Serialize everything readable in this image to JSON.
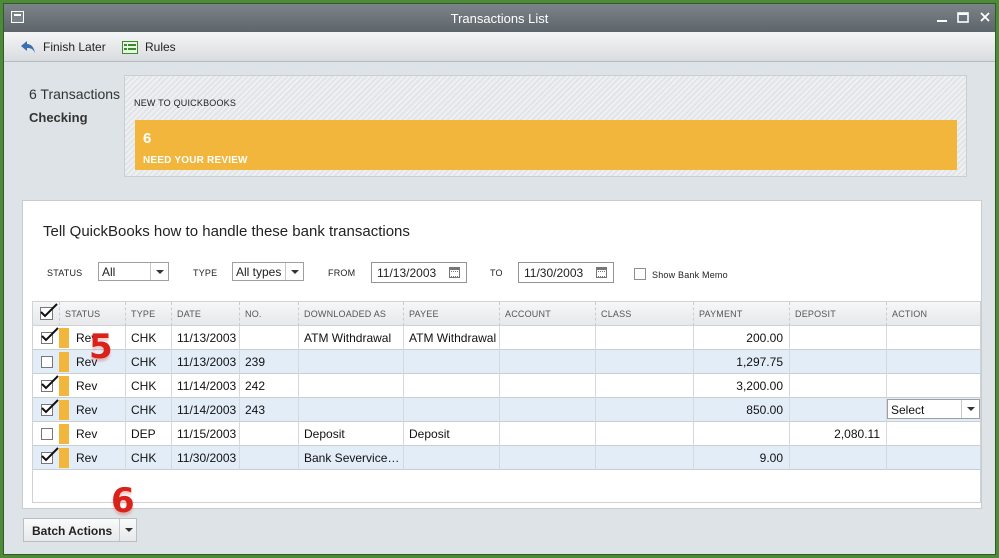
{
  "window": {
    "title": "Transactions List",
    "controls": [
      "minimize-icon",
      "maximize-icon",
      "close-icon"
    ]
  },
  "toolbar": {
    "finish_later": "Finish Later",
    "rules": "Rules"
  },
  "summary": {
    "count": "6 Transactions",
    "account": "Checking",
    "category_label": "NEW TO QUICKBOOKS",
    "review_count": "6",
    "review_label": "NEED YOUR REVIEW"
  },
  "main": {
    "heading": "Tell QuickBooks how to handle these bank transactions"
  },
  "filters": {
    "status_label": "STATUS",
    "status_value": "All",
    "type_label": "TYPE",
    "type_value": "All types",
    "from_label": "FROM",
    "from_value": "11/13/2003",
    "to_label": "TO",
    "to_value": "11/30/2003",
    "show_bank_memo": "Show Bank Memo"
  },
  "grid": {
    "columns": [
      "STATUS",
      "TYPE",
      "DATE",
      "NO.",
      "DOWNLOADED AS",
      "PAYEE",
      "ACCOUNT",
      "CLASS",
      "PAYMENT",
      "DEPOSIT",
      "ACTION"
    ],
    "rows": [
      {
        "checked": true,
        "status": "Rev",
        "type": "CHK",
        "date": "11/13/2003",
        "no": "",
        "downloaded_as": "ATM Withdrawal",
        "payee": "ATM Withdrawal",
        "account": "",
        "class": "",
        "payment": "200.00",
        "deposit": "",
        "action": ""
      },
      {
        "checked": false,
        "status": "Rev",
        "type": "CHK",
        "date": "11/13/2003",
        "no": "239",
        "downloaded_as": "",
        "payee": "",
        "account": "",
        "class": "",
        "payment": "1,297.75",
        "deposit": "",
        "action": ""
      },
      {
        "checked": true,
        "status": "Rev",
        "type": "CHK",
        "date": "11/14/2003",
        "no": "242",
        "downloaded_as": "",
        "payee": "",
        "account": "",
        "class": "",
        "payment": "3,200.00",
        "deposit": "",
        "action": ""
      },
      {
        "checked": true,
        "status": "Rev",
        "type": "CHK",
        "date": "11/14/2003",
        "no": "243",
        "downloaded_as": "",
        "payee": "",
        "account": "",
        "class": "",
        "payment": "850.00",
        "deposit": "",
        "action": "Select"
      },
      {
        "checked": false,
        "status": "Rev",
        "type": "DEP",
        "date": "11/15/2003",
        "no": "",
        "downloaded_as": "Deposit",
        "payee": "Deposit",
        "account": "",
        "class": "",
        "payment": "",
        "deposit": "2,080.11",
        "action": ""
      },
      {
        "checked": true,
        "status": "Rev",
        "type": "CHK",
        "date": "11/30/2003",
        "no": "",
        "downloaded_as": "Bank Severvice…",
        "payee": "",
        "account": "",
        "class": "",
        "payment": "9.00",
        "deposit": "",
        "action": ""
      }
    ]
  },
  "batch": {
    "label": "Batch Actions"
  },
  "annotations": {
    "step5": "5",
    "step6": "6"
  },
  "colors": {
    "accent_orange": "#f2b63c",
    "row_alt": "#e3edf8",
    "titlebar": "#6b7278",
    "annotation_red": "#d9221a"
  }
}
